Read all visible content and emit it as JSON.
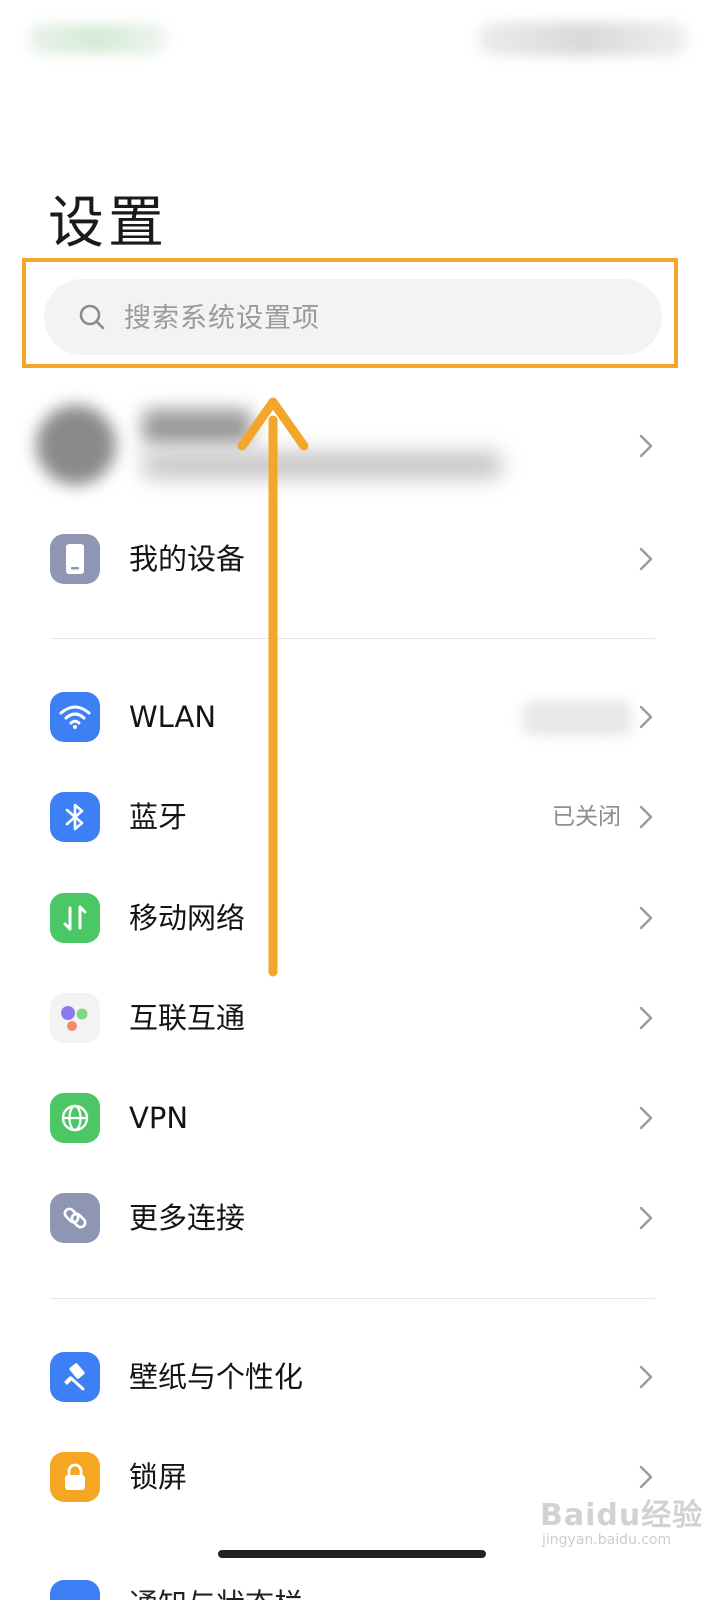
{
  "page": {
    "title": "设置"
  },
  "search": {
    "placeholder": "搜索系统设置项"
  },
  "items": [
    {
      "label": "我的设备",
      "value": "",
      "icon": "phone-icon",
      "color": "#8f96b4"
    },
    {
      "label": "WLAN",
      "value": "",
      "icon": "wifi-icon",
      "color": "#3d7ff5"
    },
    {
      "label": "蓝牙",
      "value": "已关闭",
      "icon": "bluetooth-icon",
      "color": "#3d7ff5"
    },
    {
      "label": "移动网络",
      "value": "",
      "icon": "mobile-data-icon",
      "color": "#4cc765"
    },
    {
      "label": "互联互通",
      "value": "",
      "icon": "interconnect-icon",
      "color": "#f3f3f3"
    },
    {
      "label": "VPN",
      "value": "",
      "icon": "globe-icon",
      "color": "#4cc765"
    },
    {
      "label": "更多连接",
      "value": "",
      "icon": "link-icon",
      "color": "#8f96b4"
    },
    {
      "label": "壁纸与个性化",
      "value": "",
      "icon": "brush-icon",
      "color": "#3d7ff5"
    },
    {
      "label": "锁屏",
      "value": "",
      "icon": "lock-icon",
      "color": "#f5a623"
    }
  ],
  "partial_item": {
    "label": "通知与状态栏"
  },
  "watermark": {
    "logo": "Baidu经验",
    "url": "jingyan.baidu.com"
  },
  "annotation": {
    "highlight_color": "#f4a62a"
  }
}
